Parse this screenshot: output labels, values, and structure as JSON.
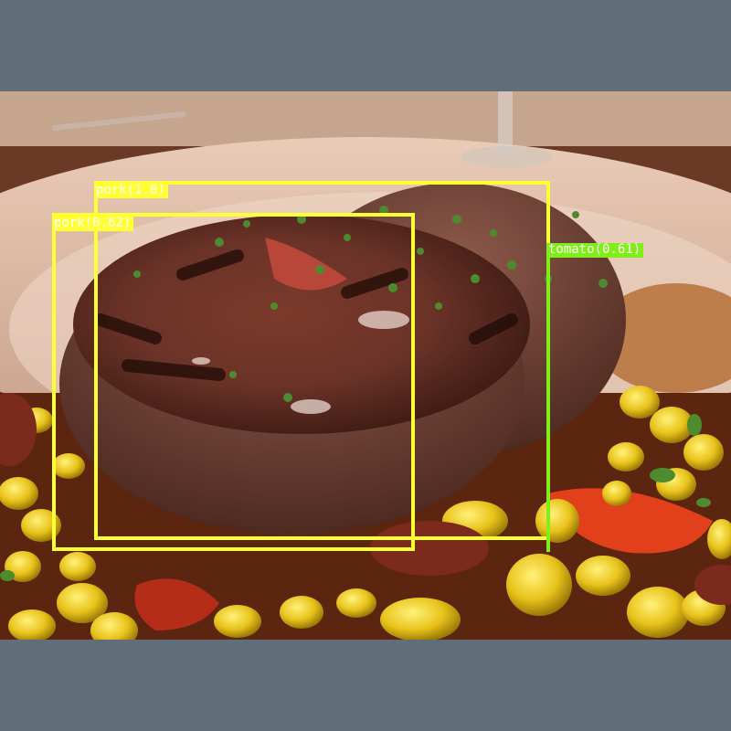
{
  "detections": [
    {
      "label": "pork(1.0)",
      "color": "#ffff33"
    },
    {
      "label": "pork(0.62)",
      "color": "#ffff33"
    },
    {
      "label": "tomato(0.61)",
      "color": "#80ee19"
    }
  ],
  "colors": {
    "background": "#5f6e79",
    "box_yellow": "#ffff33",
    "box_green": "#80ee19"
  }
}
